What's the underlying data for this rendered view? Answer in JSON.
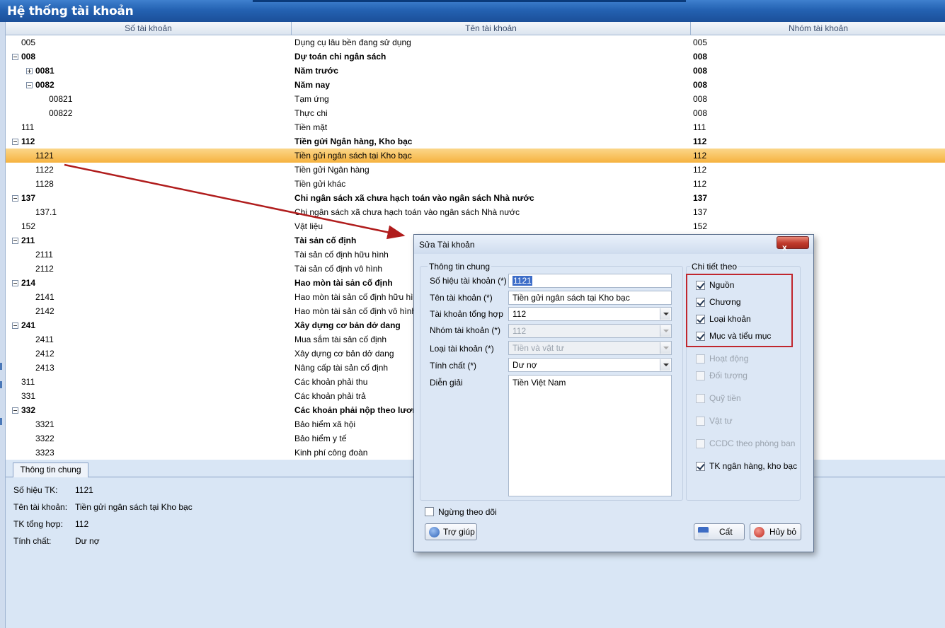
{
  "window": {
    "title": "Hệ thống tài khoản"
  },
  "grid": {
    "columns": [
      "Số tài khoản",
      "Tên tài khoản",
      "Nhóm tài khoản"
    ],
    "rows": [
      {
        "code": "005",
        "name": "Dụng cụ lâu bền đang sử dụng",
        "group": "005",
        "level": 0,
        "bold": false,
        "toggle": ""
      },
      {
        "code": "008",
        "name": "Dự toán chi ngân sách",
        "group": "008",
        "level": 0,
        "bold": true,
        "toggle": "minus"
      },
      {
        "code": "0081",
        "name": "Năm trước",
        "group": "008",
        "level": 1,
        "bold": true,
        "toggle": "plus"
      },
      {
        "code": "0082",
        "name": "Năm nay",
        "group": "008",
        "level": 1,
        "bold": true,
        "toggle": "minus"
      },
      {
        "code": "00821",
        "name": "Tạm ứng",
        "group": "008",
        "level": 2,
        "bold": false,
        "toggle": ""
      },
      {
        "code": "00822",
        "name": "Thực chi",
        "group": "008",
        "level": 2,
        "bold": false,
        "toggle": ""
      },
      {
        "code": "111",
        "name": "Tiền mặt",
        "group": "111",
        "level": 0,
        "bold": false,
        "toggle": ""
      },
      {
        "code": "112",
        "name": "Tiền gửi Ngân hàng, Kho bạc",
        "group": "112",
        "level": 0,
        "bold": true,
        "toggle": "minus"
      },
      {
        "code": "1121",
        "name": "Tiền gửi ngân sách tại Kho bạc",
        "group": "112",
        "level": 1,
        "bold": false,
        "toggle": "",
        "selected": true
      },
      {
        "code": "1122",
        "name": "Tiền gửi Ngân hàng",
        "group": "112",
        "level": 1,
        "bold": false,
        "toggle": ""
      },
      {
        "code": "1128",
        "name": "Tiền gửi khác",
        "group": "112",
        "level": 1,
        "bold": false,
        "toggle": ""
      },
      {
        "code": "137",
        "name": "Chi ngân sách xã chưa hạch toán vào ngân sách Nhà nước",
        "group": "137",
        "level": 0,
        "bold": true,
        "toggle": "minus"
      },
      {
        "code": "137.1",
        "name": "Chi ngân sách xã chưa hạch toán vào ngân sách Nhà nước",
        "group": "137",
        "level": 1,
        "bold": false,
        "toggle": ""
      },
      {
        "code": "152",
        "name": "Vật liệu",
        "group": "152",
        "level": 0,
        "bold": false,
        "toggle": ""
      },
      {
        "code": "211",
        "name": "Tài sản cố định",
        "group": "",
        "level": 0,
        "bold": true,
        "toggle": "minus"
      },
      {
        "code": "2111",
        "name": "Tài sản cố định hữu hình",
        "group": "",
        "level": 1,
        "bold": false,
        "toggle": ""
      },
      {
        "code": "2112",
        "name": "Tài sản cố định vô hình",
        "group": "",
        "level": 1,
        "bold": false,
        "toggle": ""
      },
      {
        "code": "214",
        "name": "Hao mòn tài sản cố định",
        "group": "",
        "level": 0,
        "bold": true,
        "toggle": "minus"
      },
      {
        "code": "2141",
        "name": "Hao mòn tài sản cố định hữu hình",
        "group": "",
        "level": 1,
        "bold": false,
        "toggle": ""
      },
      {
        "code": "2142",
        "name": "Hao mòn tài sản cố định vô hình",
        "group": "",
        "level": 1,
        "bold": false,
        "toggle": ""
      },
      {
        "code": "241",
        "name": "Xây dựng cơ bản dở dang",
        "group": "",
        "level": 0,
        "bold": true,
        "toggle": "minus"
      },
      {
        "code": "2411",
        "name": "Mua sắm tài sản cố định",
        "group": "",
        "level": 1,
        "bold": false,
        "toggle": ""
      },
      {
        "code": "2412",
        "name": "Xây dựng cơ bản dở dang",
        "group": "",
        "level": 1,
        "bold": false,
        "toggle": ""
      },
      {
        "code": "2413",
        "name": "Nâng cấp tài sản cố định",
        "group": "",
        "level": 1,
        "bold": false,
        "toggle": ""
      },
      {
        "code": "311",
        "name": "Các khoản phải thu",
        "group": "",
        "level": 0,
        "bold": false,
        "toggle": ""
      },
      {
        "code": "331",
        "name": "Các khoản phải trả",
        "group": "",
        "level": 0,
        "bold": false,
        "toggle": ""
      },
      {
        "code": "332",
        "name": "Các khoản phải nộp theo lương",
        "group": "",
        "level": 0,
        "bold": true,
        "toggle": "minus"
      },
      {
        "code": "3321",
        "name": "Bảo hiểm xã hội",
        "group": "",
        "level": 1,
        "bold": false,
        "toggle": ""
      },
      {
        "code": "3322",
        "name": "Bảo hiểm y tế",
        "group": "",
        "level": 1,
        "bold": false,
        "toggle": ""
      },
      {
        "code": "3323",
        "name": "Kinh phí công đoàn",
        "group": "",
        "level": 1,
        "bold": false,
        "toggle": ""
      }
    ]
  },
  "detail": {
    "tab": "Thông tin chung",
    "fields": [
      {
        "label": "Số hiệu TK:",
        "value": "1121"
      },
      {
        "label": "Tên tài khoản:",
        "value": "Tiền gửi ngân sách tại Kho bạc"
      },
      {
        "label": "TK tổng hợp:",
        "value": "112"
      },
      {
        "label": "Tính chất:",
        "value": "Dư nợ"
      }
    ]
  },
  "dialog": {
    "title": "Sửa Tài khoản",
    "close_label": "x",
    "general_title": "Thông tin chung",
    "labels": {
      "account_no": "Số hiệu tài khoản (*)",
      "account_name": "Tên tài khoản (*)",
      "parent": "Tài khoản tổng hợp",
      "group": "Nhóm tài khoản (*)",
      "type": "Loại tài khoản (*)",
      "nature": "Tính chất (*)",
      "description": "Diễn giải"
    },
    "values": {
      "account_no": "1121",
      "account_name": "Tiền gửi ngân sách tại Kho bạc",
      "parent": "112",
      "group": "112",
      "type": "Tiền và vật tư",
      "nature": "Dư nợ",
      "description": "Tiền Việt Nam"
    },
    "inactive_label": "Ngừng theo dõi",
    "detail_title": "Chi tiết theo",
    "detail_options": [
      {
        "label": "Nguồn",
        "checked": true,
        "disabled": false
      },
      {
        "label": "Chương",
        "checked": true,
        "disabled": false
      },
      {
        "label": "Loại khoản",
        "checked": true,
        "disabled": false
      },
      {
        "label": "Mục và tiểu mục",
        "checked": true,
        "disabled": false
      },
      {
        "label": "Hoạt động",
        "checked": false,
        "disabled": true
      },
      {
        "label": "Đối tượng",
        "checked": false,
        "disabled": true
      },
      {
        "label": "Quỹ tiền",
        "checked": false,
        "disabled": true
      },
      {
        "label": "Vật tư",
        "checked": false,
        "disabled": true
      },
      {
        "label": "CCDC theo phòng ban",
        "checked": false,
        "disabled": true
      },
      {
        "label": "TK ngân hàng, kho bạc",
        "checked": true,
        "disabled": false
      }
    ],
    "buttons": {
      "help": "Trợ giúp",
      "save": "Cất",
      "cancel": "Hủy bỏ"
    }
  },
  "colors": {
    "selection": "#f6b23f",
    "title_bar": "#2462b2",
    "highlight_box": "#c0262d",
    "arrow": "#b01c1c"
  }
}
